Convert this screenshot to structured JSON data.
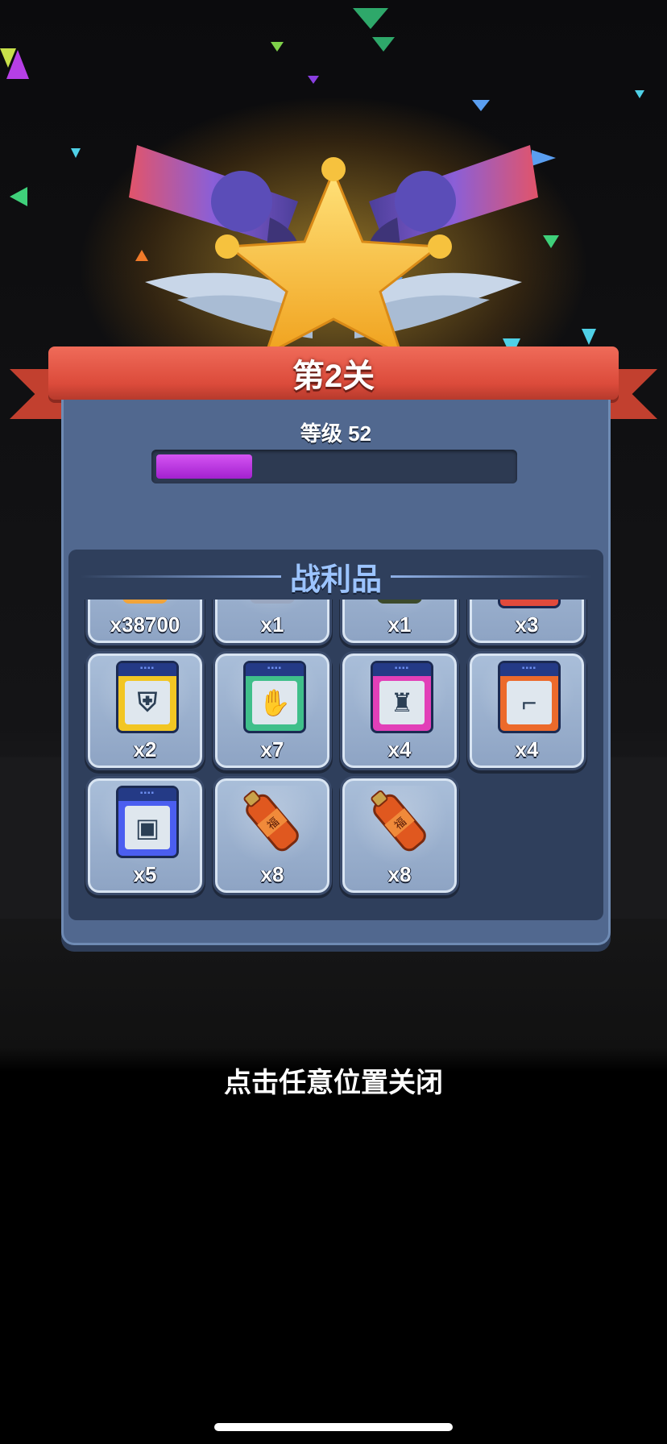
{
  "stage": {
    "title": "第2关",
    "level_label": "等级 52",
    "level_progress": 0.27
  },
  "loot": {
    "title": "战利品",
    "items": [
      {
        "icon": "gold-bar-icon",
        "count": "x38700",
        "color": "#f1a43a"
      },
      {
        "icon": "gun-icon",
        "count": "x1",
        "color": "#9aa7c0"
      },
      {
        "icon": "grenade-icon",
        "count": "x1",
        "color": "#3c4a2b"
      },
      {
        "icon": "red-card-icon",
        "count": "x3",
        "color": "#e14a3c"
      },
      {
        "icon": "yellow-armor-card-icon",
        "count": "x2",
        "color": "#f2c623"
      },
      {
        "icon": "green-glove-card-icon",
        "count": "x7",
        "color": "#3fbf8a"
      },
      {
        "icon": "pink-vest-card-icon",
        "count": "x4",
        "color": "#e23fb8"
      },
      {
        "icon": "orange-boots-card-icon",
        "count": "x4",
        "color": "#ec6a2b"
      },
      {
        "icon": "blue-robot-card-icon",
        "count": "x5",
        "color": "#4b5ef0"
      },
      {
        "icon": "red-canister-icon",
        "count": "x8",
        "color": "#e0581f"
      },
      {
        "icon": "red-canister-icon",
        "count": "x8",
        "color": "#e0581f"
      }
    ]
  },
  "close_hint": "点击任意位置关闭",
  "colors": {
    "ribbon": "#dc4b3b",
    "panel": "#51688f",
    "progress_fill": "#b72fe0",
    "loot_title": "#9cc4ff"
  }
}
